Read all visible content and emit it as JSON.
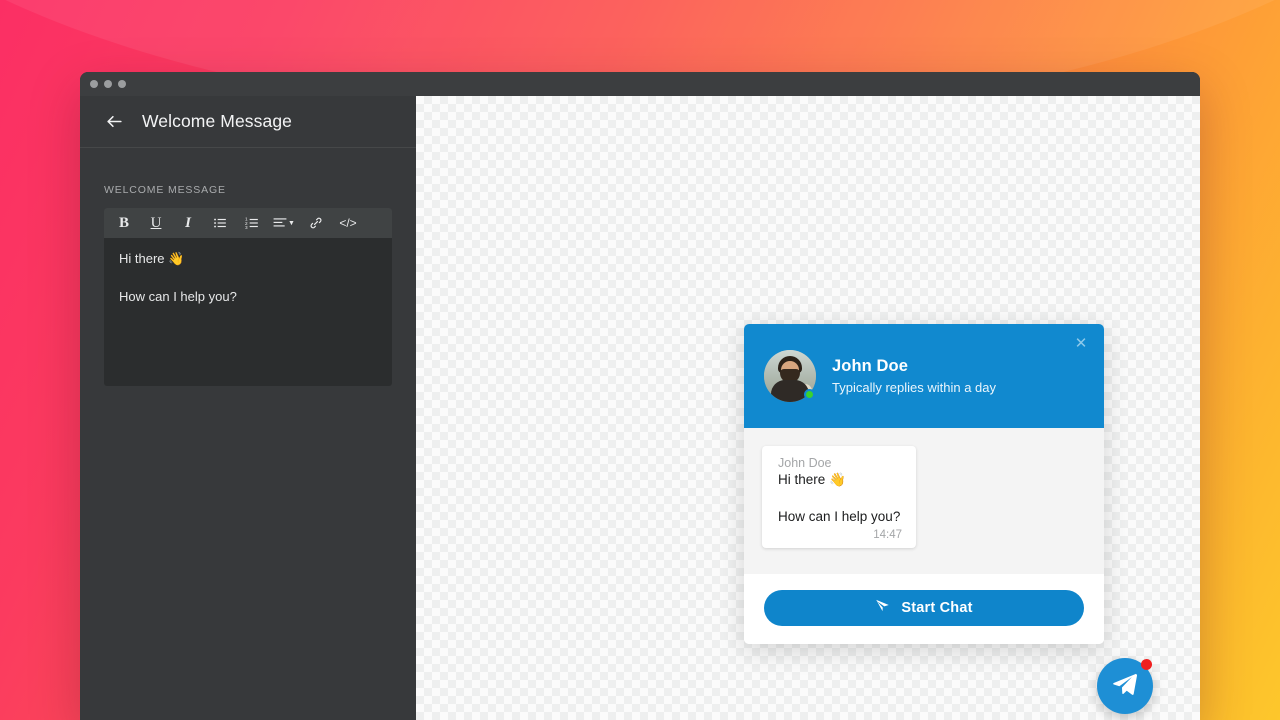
{
  "window": {
    "traffic_lights": [
      "close-dot",
      "minimize-dot",
      "maximize-dot"
    ]
  },
  "sidebar": {
    "back_icon": "back-arrow-icon",
    "title": "Welcome Message",
    "field_label": "WELCOME MESSAGE",
    "toolbar": [
      {
        "name": "bold-button",
        "glyph": "B",
        "icon": "bold-icon"
      },
      {
        "name": "underline-button",
        "glyph": "U",
        "icon": "underline-icon"
      },
      {
        "name": "italic-button",
        "glyph": "I",
        "icon": "italic-icon"
      },
      {
        "name": "bullet-list-button",
        "glyph": "",
        "icon": "unordered-list-icon"
      },
      {
        "name": "numbered-list-button",
        "glyph": "",
        "icon": "ordered-list-icon"
      },
      {
        "name": "align-button",
        "glyph": "",
        "icon": "align-left-icon"
      },
      {
        "name": "link-button",
        "glyph": "",
        "icon": "link-icon"
      },
      {
        "name": "code-button",
        "glyph": "</>",
        "icon": "code-icon"
      }
    ],
    "editor": {
      "line1": "Hi there 👋",
      "line2": "How can I help you?"
    }
  },
  "widget": {
    "close_icon": "close-icon",
    "agent_name": "John Doe",
    "agent_status": "Typically replies within a day",
    "avatar_alt": "avatar",
    "online": true,
    "message": {
      "author": "John Doe",
      "line1": "Hi there 👋",
      "line2": "How can I help you?",
      "time": "14:47"
    },
    "start_button": "Start Chat",
    "start_icon": "paper-plane-icon"
  },
  "launcher": {
    "icon": "paper-plane-icon",
    "badge": ""
  },
  "colors": {
    "brand_blue": "#1189cf",
    "button_blue": "#0f85cb",
    "online_green": "#3ad22e",
    "badge_red": "#f01f1f",
    "gradient_start": "#fb2f64",
    "gradient_end": "#fdc72b",
    "sidebar_bg": "#37393b",
    "editor_bg": "#2b2d2e"
  }
}
